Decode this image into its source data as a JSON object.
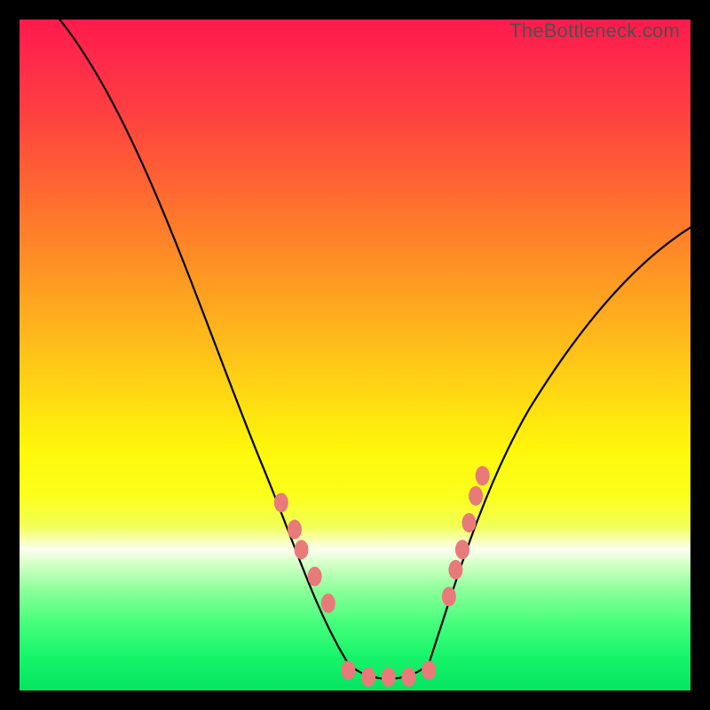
{
  "watermark": "TheBottleneck.com",
  "colors": {
    "background": "#000000",
    "curve_stroke": "#000000",
    "marker_fill": "#e87a7a"
  },
  "chart_data": {
    "type": "line",
    "title": "",
    "xlabel": "",
    "ylabel": "",
    "xlim": [
      0,
      100
    ],
    "ylim": [
      0,
      100
    ],
    "grid": false,
    "legend": false,
    "series": [
      {
        "name": "bottleneck-curve",
        "x": [
          4,
          8,
          12,
          16,
          20,
          24,
          28,
          32,
          36,
          40,
          44,
          46,
          48,
          50,
          52,
          54,
          56,
          58,
          62,
          66,
          70,
          74,
          78,
          82,
          86,
          90,
          94,
          98,
          100
        ],
        "y": [
          100,
          92,
          84,
          76,
          68,
          60,
          52,
          44,
          36,
          28,
          20,
          16,
          12,
          8,
          4,
          2,
          1,
          2,
          8,
          16,
          24,
          32,
          40,
          48,
          54,
          60,
          66,
          70,
          72
        ]
      }
    ],
    "markers": {
      "left_cluster": [
        {
          "x": 39,
          "y": 28
        },
        {
          "x": 41,
          "y": 24
        },
        {
          "x": 42,
          "y": 21
        },
        {
          "x": 44,
          "y": 17
        },
        {
          "x": 46,
          "y": 13
        }
      ],
      "bottom_cluster": [
        {
          "x": 49,
          "y": 3
        },
        {
          "x": 52,
          "y": 2
        },
        {
          "x": 55,
          "y": 2
        },
        {
          "x": 58,
          "y": 2
        },
        {
          "x": 61,
          "y": 3
        }
      ],
      "right_cluster": [
        {
          "x": 64,
          "y": 14
        },
        {
          "x": 65,
          "y": 18
        },
        {
          "x": 66,
          "y": 21
        },
        {
          "x": 67,
          "y": 25
        },
        {
          "x": 68,
          "y": 29
        },
        {
          "x": 69,
          "y": 32
        }
      ]
    }
  }
}
